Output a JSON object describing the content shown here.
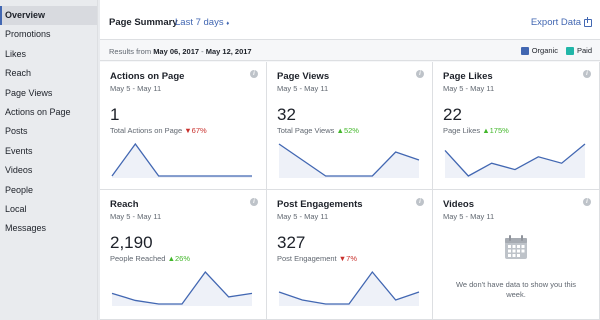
{
  "sidebar": {
    "items": [
      {
        "label": "Overview",
        "active": true
      },
      {
        "label": "Promotions"
      },
      {
        "label": "Likes"
      },
      {
        "label": "Reach"
      },
      {
        "label": "Page Views"
      },
      {
        "label": "Actions on Page"
      },
      {
        "label": "Posts"
      },
      {
        "label": "Events"
      },
      {
        "label": "Videos"
      },
      {
        "label": "People"
      },
      {
        "label": "Local"
      },
      {
        "label": "Messages"
      }
    ]
  },
  "header": {
    "title": "Page Summary",
    "range": "Last 7 days",
    "range_arrow": "♦",
    "export": "Export Data"
  },
  "results": {
    "prefix": "Results from",
    "start": "May 06, 2017",
    "sep": " - ",
    "end": "May 12, 2017"
  },
  "legend": [
    {
      "label": "Organic",
      "color": "#4267b2"
    },
    {
      "label": "Paid",
      "color": "#21b6a8"
    }
  ],
  "cards": [
    {
      "title": "Actions on Page",
      "date": "May 5 - May 11",
      "value": "1",
      "sub": "Total Actions on Page",
      "arrow": "▼",
      "change": "67%",
      "dir": "down",
      "spark": [
        0,
        1,
        0,
        0,
        0,
        0,
        0
      ]
    },
    {
      "title": "Page Views",
      "date": "May 5 - May 11",
      "value": "32",
      "sub": "Total Page Views",
      "arrow": "▲",
      "change": "52%",
      "dir": "up",
      "spark": [
        10,
        6,
        2,
        2,
        2,
        8,
        6
      ]
    },
    {
      "title": "Page Likes",
      "date": "May 5 - May 11",
      "value": "22",
      "sub": "Page Likes",
      "arrow": "▲",
      "change": "175%",
      "dir": "up",
      "spark": [
        5,
        1,
        3,
        2,
        4,
        3,
        6
      ]
    },
    {
      "title": "Reach",
      "date": "May 5 - May 11",
      "value": "2,190",
      "sub": "People Reached",
      "arrow": "▲",
      "change": "26%",
      "dir": "up",
      "spark": [
        3,
        1,
        0,
        0,
        9,
        2,
        3
      ]
    },
    {
      "title": "Post Engagements",
      "date": "May 5 - May 11",
      "value": "327",
      "sub": "Post Engagement",
      "arrow": "▼",
      "change": "7%",
      "dir": "down",
      "spark": [
        3,
        1,
        0,
        0,
        8,
        1,
        3
      ]
    },
    {
      "title": "Videos",
      "date": "May 5 - May 11",
      "nodata": "We don't have data to show you this week.",
      "icon": "calendar-icon"
    }
  ],
  "info_glyph": "i"
}
